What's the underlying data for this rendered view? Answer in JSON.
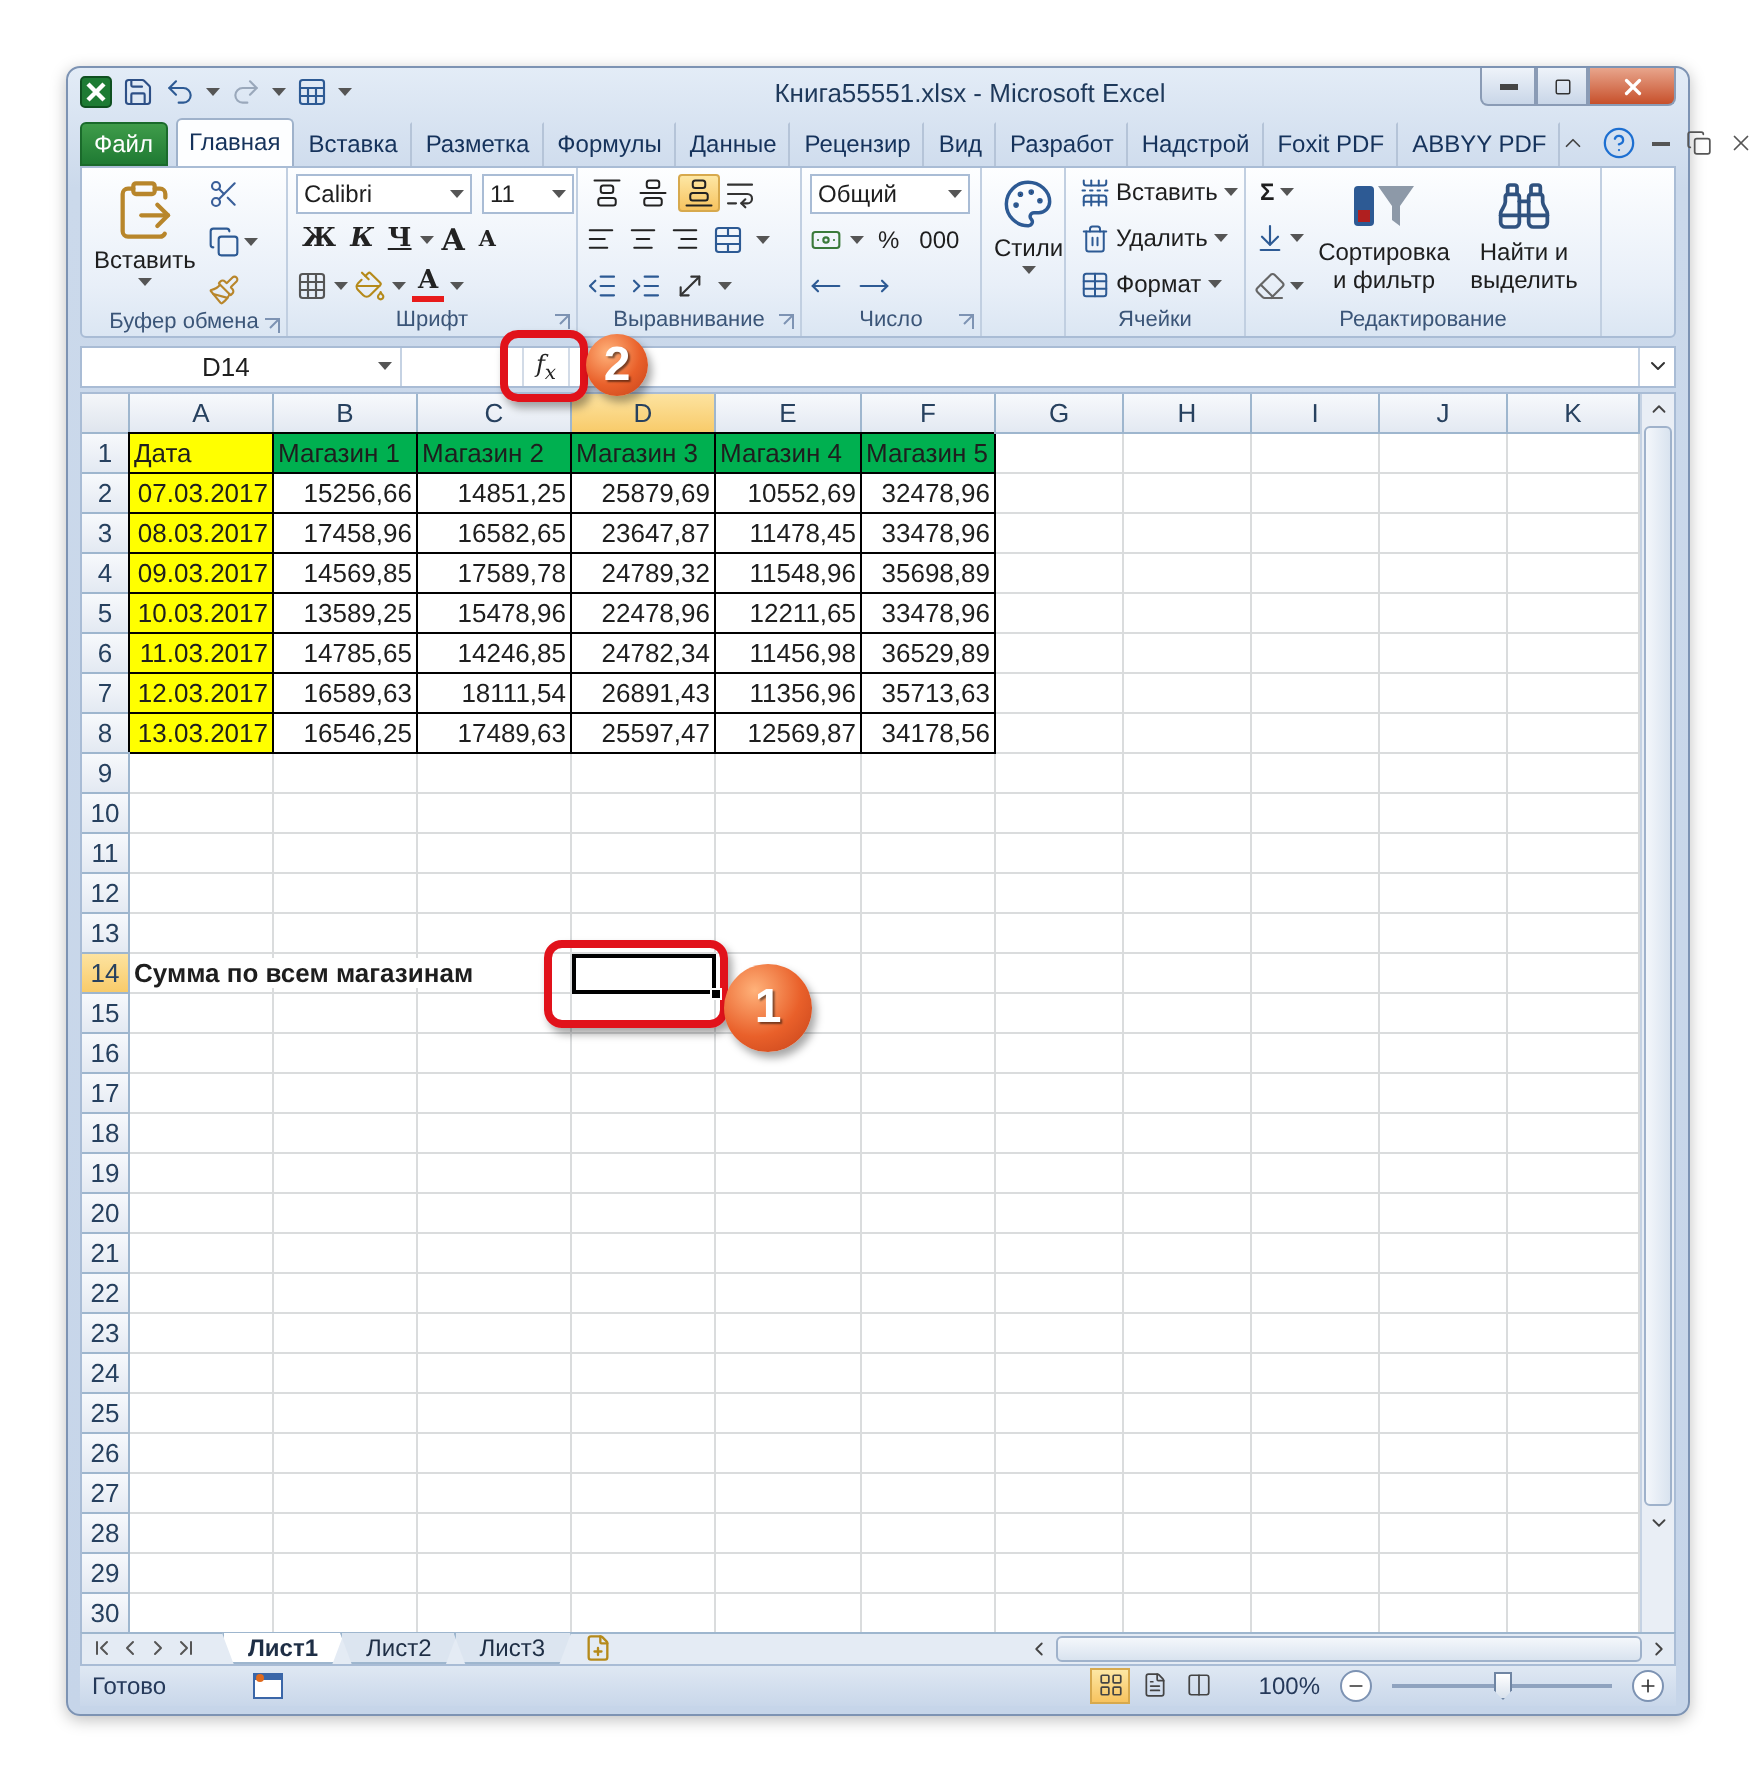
{
  "window": {
    "title": "Книга55551.xlsx - Microsoft Excel"
  },
  "tabs": [
    {
      "label": "Файл",
      "kind": "file",
      "selected": false
    },
    {
      "label": "Главная",
      "kind": "tab",
      "selected": true
    },
    {
      "label": "Вставка",
      "kind": "tab",
      "selected": false
    },
    {
      "label": "Разметка",
      "kind": "tab",
      "selected": false
    },
    {
      "label": "Формулы",
      "kind": "tab",
      "selected": false
    },
    {
      "label": "Данные",
      "kind": "tab",
      "selected": false
    },
    {
      "label": "Рецензир",
      "kind": "tab",
      "selected": false
    },
    {
      "label": "Вид",
      "kind": "tab",
      "selected": false
    },
    {
      "label": "Разработ",
      "kind": "tab",
      "selected": false
    },
    {
      "label": "Надстрой",
      "kind": "tab",
      "selected": false
    },
    {
      "label": "Foxit PDF",
      "kind": "tab",
      "selected": false
    },
    {
      "label": "ABBYY PDF",
      "kind": "tab",
      "selected": false
    }
  ],
  "ribbon": {
    "groups": [
      {
        "kind": "clipboard",
        "label": "Буфер обмена",
        "launcher": true,
        "paste": "Вставить"
      },
      {
        "kind": "font",
        "label": "Шрифт",
        "launcher": true,
        "font": "Calibri",
        "size": "11",
        "style_buttons": [
          "Ж",
          "К",
          "Ч"
        ],
        "grow": "A",
        "shrink": "A",
        "font_color": "A"
      },
      {
        "kind": "alignment",
        "label": "Выравнивание",
        "launcher": true,
        "vertical_align": [
          {
            "selected": false
          },
          {
            "selected": false
          },
          {
            "selected": true
          }
        ]
      },
      {
        "kind": "number",
        "label": "Число",
        "launcher": true,
        "format": "Общий",
        "percent": "%",
        "thousands": "000"
      },
      {
        "kind": "styles",
        "button": "Стили"
      },
      {
        "kind": "cells",
        "label": "Ячейки",
        "buttons": [
          {
            "label": "Вставить",
            "kind": "insert"
          },
          {
            "label": "Удалить",
            "kind": "delete"
          },
          {
            "label": "Формат",
            "kind": "format"
          }
        ]
      },
      {
        "kind": "editing",
        "label": "Редактирование",
        "sum": "Σ",
        "sort": "Сортировка и фильтр",
        "find": "Найти и выделить"
      }
    ]
  },
  "formula_bar": {
    "name_box": "D14",
    "fx": "f$_{x}$"
  },
  "callouts": [
    {
      "number": "2",
      "kind": "formula"
    },
    {
      "number": "1",
      "kind": "cell"
    }
  ],
  "sheet": {
    "columns": [
      {
        "label": "A",
        "selected": false
      },
      {
        "label": "B",
        "selected": false
      },
      {
        "label": "C",
        "selected": false
      },
      {
        "label": "D",
        "selected": true
      },
      {
        "label": "E",
        "selected": false
      },
      {
        "label": "F",
        "selected": false
      },
      {
        "label": "G",
        "selected": false
      },
      {
        "label": "H",
        "selected": false
      },
      {
        "label": "I",
        "selected": false
      },
      {
        "label": "J",
        "selected": false
      },
      {
        "label": "K",
        "selected": false
      }
    ],
    "rows": [
      {
        "number": "1",
        "selected": false,
        "cells": [
          {
            "text": "Дата",
            "kind": "text",
            "color": "#ffff00"
          },
          {
            "text": "Магазин 1",
            "kind": "text",
            "color": "#00b050"
          },
          {
            "text": "Магазин 2",
            "kind": "text",
            "color": "#00b050"
          },
          {
            "text": "Магазин 3",
            "kind": "text",
            "color": "#00b050"
          },
          {
            "text": "Магазин 4",
            "kind": "text",
            "color": "#00b050"
          },
          {
            "text": "Магазин 5",
            "kind": "text",
            "color": "#00b050"
          }
        ]
      },
      {
        "number": "2",
        "selected": false,
        "cells": [
          {
            "text": "07.03.2017",
            "kind": "number",
            "color": "#ffff00"
          },
          {
            "text": "15256,66",
            "kind": "number"
          },
          {
            "text": "14851,25",
            "kind": "number"
          },
          {
            "text": "25879,69",
            "kind": "number"
          },
          {
            "text": "10552,69",
            "kind": "number"
          },
          {
            "text": "32478,96",
            "kind": "number"
          }
        ]
      },
      {
        "number": "3",
        "selected": false,
        "cells": [
          {
            "text": "08.03.2017",
            "kind": "number",
            "color": "#ffff00"
          },
          {
            "text": "17458,96",
            "kind": "number"
          },
          {
            "text": "16582,65",
            "kind": "number"
          },
          {
            "text": "23647,87",
            "kind": "number"
          },
          {
            "text": "11478,45",
            "kind": "number"
          },
          {
            "text": "33478,96",
            "kind": "number"
          }
        ]
      },
      {
        "number": "4",
        "selected": false,
        "cells": [
          {
            "text": "09.03.2017",
            "kind": "number",
            "color": "#ffff00"
          },
          {
            "text": "14569,85",
            "kind": "number"
          },
          {
            "text": "17589,78",
            "kind": "number"
          },
          {
            "text": "24789,32",
            "kind": "number"
          },
          {
            "text": "11548,96",
            "kind": "number"
          },
          {
            "text": "35698,89",
            "kind": "number"
          }
        ]
      },
      {
        "number": "5",
        "selected": false,
        "cells": [
          {
            "text": "10.03.2017",
            "kind": "number",
            "color": "#ffff00"
          },
          {
            "text": "13589,25",
            "kind": "number"
          },
          {
            "text": "15478,96",
            "kind": "number"
          },
          {
            "text": "22478,96",
            "kind": "number"
          },
          {
            "text": "12211,65",
            "kind": "number"
          },
          {
            "text": "33478,96",
            "kind": "number"
          }
        ]
      },
      {
        "number": "6",
        "selected": false,
        "cells": [
          {
            "text": "11.03.2017",
            "kind": "number",
            "color": "#ffff00"
          },
          {
            "text": "14785,65",
            "kind": "number"
          },
          {
            "text": "14246,85",
            "kind": "number"
          },
          {
            "text": "24782,34",
            "kind": "number"
          },
          {
            "text": "11456,98",
            "kind": "number"
          },
          {
            "text": "36529,89",
            "kind": "number"
          }
        ]
      },
      {
        "number": "7",
        "selected": false,
        "cells": [
          {
            "text": "12.03.2017",
            "kind": "number",
            "color": "#ffff00"
          },
          {
            "text": "16589,63",
            "kind": "number"
          },
          {
            "text": "18111,54",
            "kind": "number"
          },
          {
            "text": "26891,43",
            "kind": "number"
          },
          {
            "text": "11356,96",
            "kind": "number"
          },
          {
            "text": "35713,63",
            "kind": "number"
          }
        ]
      },
      {
        "number": "8",
        "selected": false,
        "cells": [
          {
            "text": "13.03.2017",
            "kind": "number",
            "color": "#ffff00"
          },
          {
            "text": "16546,25",
            "kind": "number"
          },
          {
            "text": "17489,63",
            "kind": "number"
          },
          {
            "text": "25597,47",
            "kind": "number"
          },
          {
            "text": "12569,87",
            "kind": "number"
          },
          {
            "text": "34178,56",
            "kind": "number"
          }
        ]
      },
      {
        "number": "9",
        "selected": false
      },
      {
        "number": "10",
        "selected": false
      },
      {
        "number": "11",
        "selected": false
      },
      {
        "number": "12",
        "selected": false
      },
      {
        "number": "13",
        "selected": false
      },
      {
        "number": "14",
        "selected": true,
        "cells": [
          {
            "text": "Сумма по всем магазинам",
            "kind": "note"
          }
        ]
      },
      {
        "number": "15",
        "selected": false
      },
      {
        "number": "16",
        "selected": false
      },
      {
        "number": "17",
        "selected": false
      },
      {
        "number": "18",
        "selected": false
      },
      {
        "number": "19",
        "selected": false
      },
      {
        "number": "20",
        "selected": false
      },
      {
        "number": "21",
        "selected": false
      },
      {
        "number": "22",
        "selected": false
      },
      {
        "number": "23",
        "selected": false
      },
      {
        "number": "24",
        "selected": false
      },
      {
        "number": "25",
        "selected": false
      },
      {
        "number": "26",
        "selected": false
      },
      {
        "number": "27",
        "selected": false
      },
      {
        "number": "28",
        "selected": false
      },
      {
        "number": "29",
        "selected": false
      },
      {
        "number": "30",
        "selected": false
      }
    ]
  },
  "sheet_tabs": [
    {
      "label": "Лист1",
      "selected": true
    },
    {
      "label": "Лист2",
      "selected": false
    },
    {
      "label": "Лист3",
      "selected": false
    }
  ],
  "status_bar": {
    "text": "Готово",
    "views": [
      {
        "kind": "normal",
        "selected": true
      },
      {
        "kind": "layout",
        "selected": false
      },
      {
        "kind": "pagebreak",
        "selected": false
      }
    ],
    "zoom": "100%",
    "zoom_slider": {
      "level": 0.5
    }
  }
}
